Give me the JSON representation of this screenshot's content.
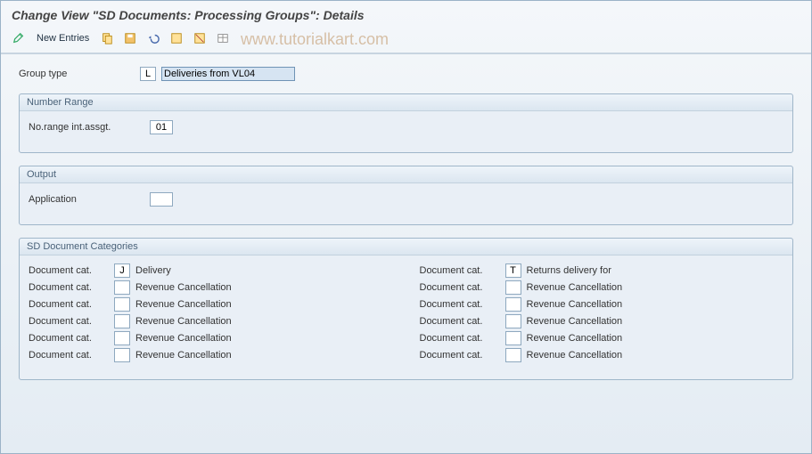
{
  "title": "Change View \"SD Documents: Processing Groups\": Details",
  "watermark": "www.tutorialkart.com",
  "toolbar": {
    "new_entries": "New Entries"
  },
  "group_type": {
    "label": "Group type",
    "code": "L",
    "desc": "Deliveries from VL04"
  },
  "number_range": {
    "title": "Number Range",
    "field_label": "No.range int.assgt.",
    "value": "01"
  },
  "output": {
    "title": "Output",
    "field_label": "Application",
    "value": ""
  },
  "categories": {
    "title": "SD Document Categories",
    "col_label": "Document cat.",
    "left": [
      {
        "code": "J",
        "desc": "Delivery"
      },
      {
        "code": "",
        "desc": "Revenue Cancellation"
      },
      {
        "code": "",
        "desc": "Revenue Cancellation"
      },
      {
        "code": "",
        "desc": "Revenue Cancellation"
      },
      {
        "code": "",
        "desc": "Revenue Cancellation"
      },
      {
        "code": "",
        "desc": "Revenue Cancellation"
      }
    ],
    "right": [
      {
        "code": "T",
        "desc": "Returns delivery for"
      },
      {
        "code": "",
        "desc": "Revenue Cancellation"
      },
      {
        "code": "",
        "desc": "Revenue Cancellation"
      },
      {
        "code": "",
        "desc": "Revenue Cancellation"
      },
      {
        "code": "",
        "desc": "Revenue Cancellation"
      },
      {
        "code": "",
        "desc": "Revenue Cancellation"
      }
    ]
  }
}
